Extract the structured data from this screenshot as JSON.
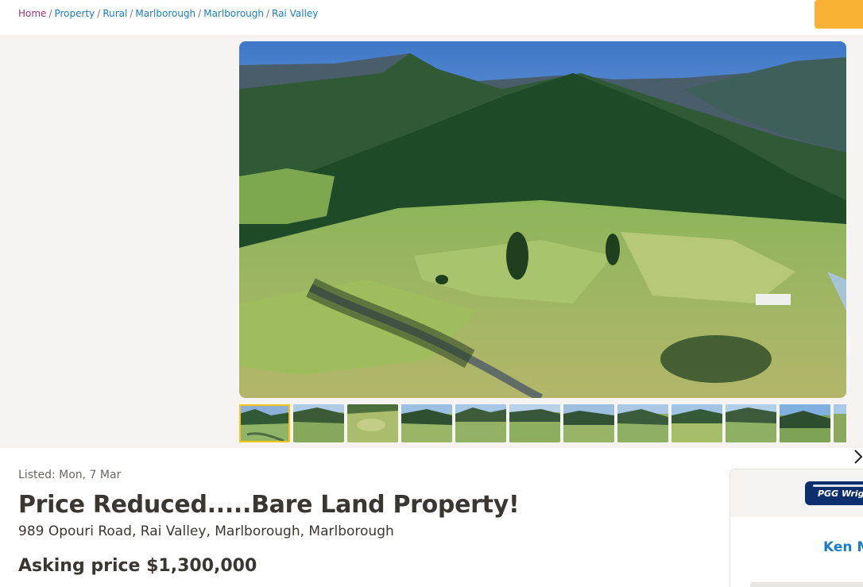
{
  "breadcrumb": [
    {
      "label": "Home"
    },
    {
      "label": "Property"
    },
    {
      "label": "Rural"
    },
    {
      "label": "Marlborough"
    },
    {
      "label": "Marlborough"
    },
    {
      "label": "Rai Valley"
    }
  ],
  "breadcrumb_separator": "/",
  "listing": {
    "listed": "Listed: Mon, 7 Mar",
    "title": "Price Reduced.....Bare Land Property!",
    "address": "989 Opouri Road, Rai Valley, Marlborough, Marlborough",
    "price": "Asking price $1,300,000"
  },
  "gallery": {
    "thumbnail_count": 12,
    "active_thumbnail": 1,
    "next_icon": "chevron-right-icon"
  },
  "agent": {
    "agency_logo_text": "PGG Wright",
    "name": "Ken M"
  },
  "colors": {
    "link": "#1a7dc4",
    "home_link": "#a0346e",
    "accent": "#f9b233",
    "active_thumb": "#f5c518",
    "agency_brand": "#0d2f6e"
  }
}
